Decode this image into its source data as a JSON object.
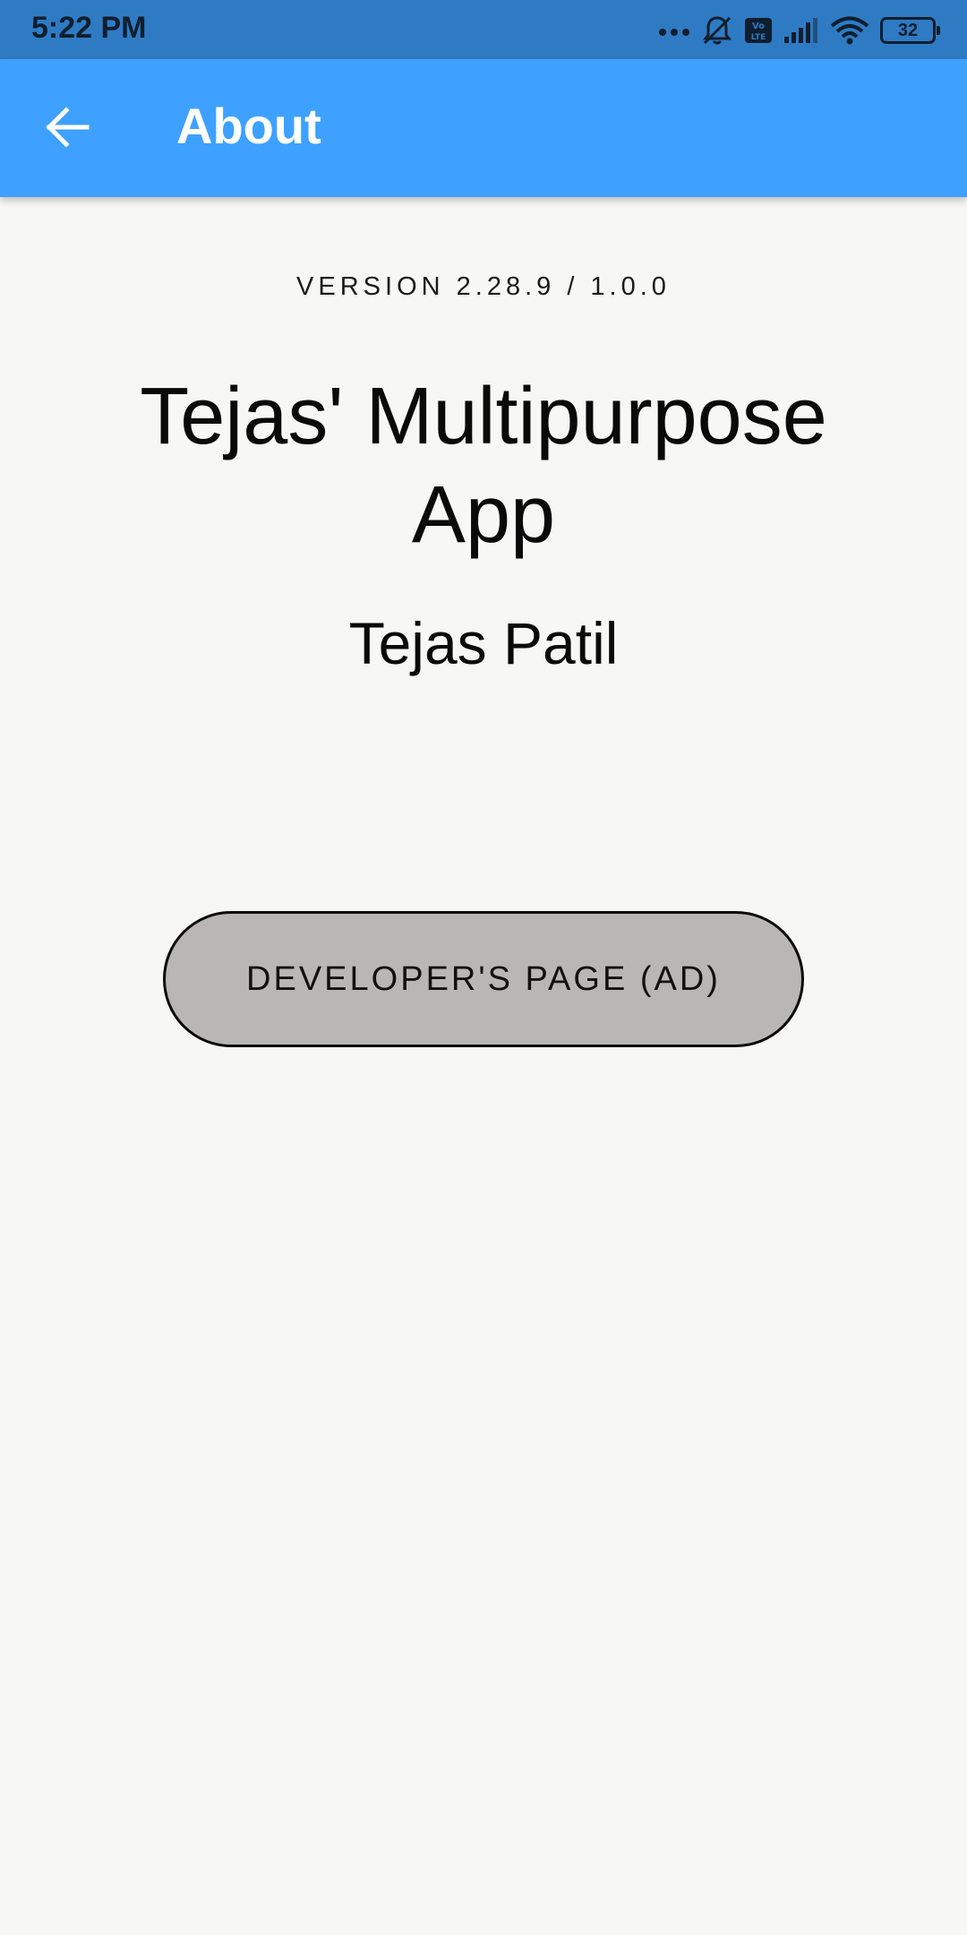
{
  "status_bar": {
    "time": "5:22 PM",
    "battery_level": "32",
    "icons": [
      "more-dots-icon",
      "muted-bell-icon",
      "volte-icon",
      "signal-icon",
      "wifi-icon",
      "battery-icon"
    ]
  },
  "app_bar": {
    "title": "About",
    "back_icon": "arrow-back-icon",
    "background_color": "#3ea1ff"
  },
  "about": {
    "version": "VERSION 2.28.9 / 1.0.0",
    "app_name": "Tejas' Multipurpose App",
    "author": "Tejas Patil",
    "developer_button_label": "DEVELOPER'S PAGE (AD)"
  }
}
